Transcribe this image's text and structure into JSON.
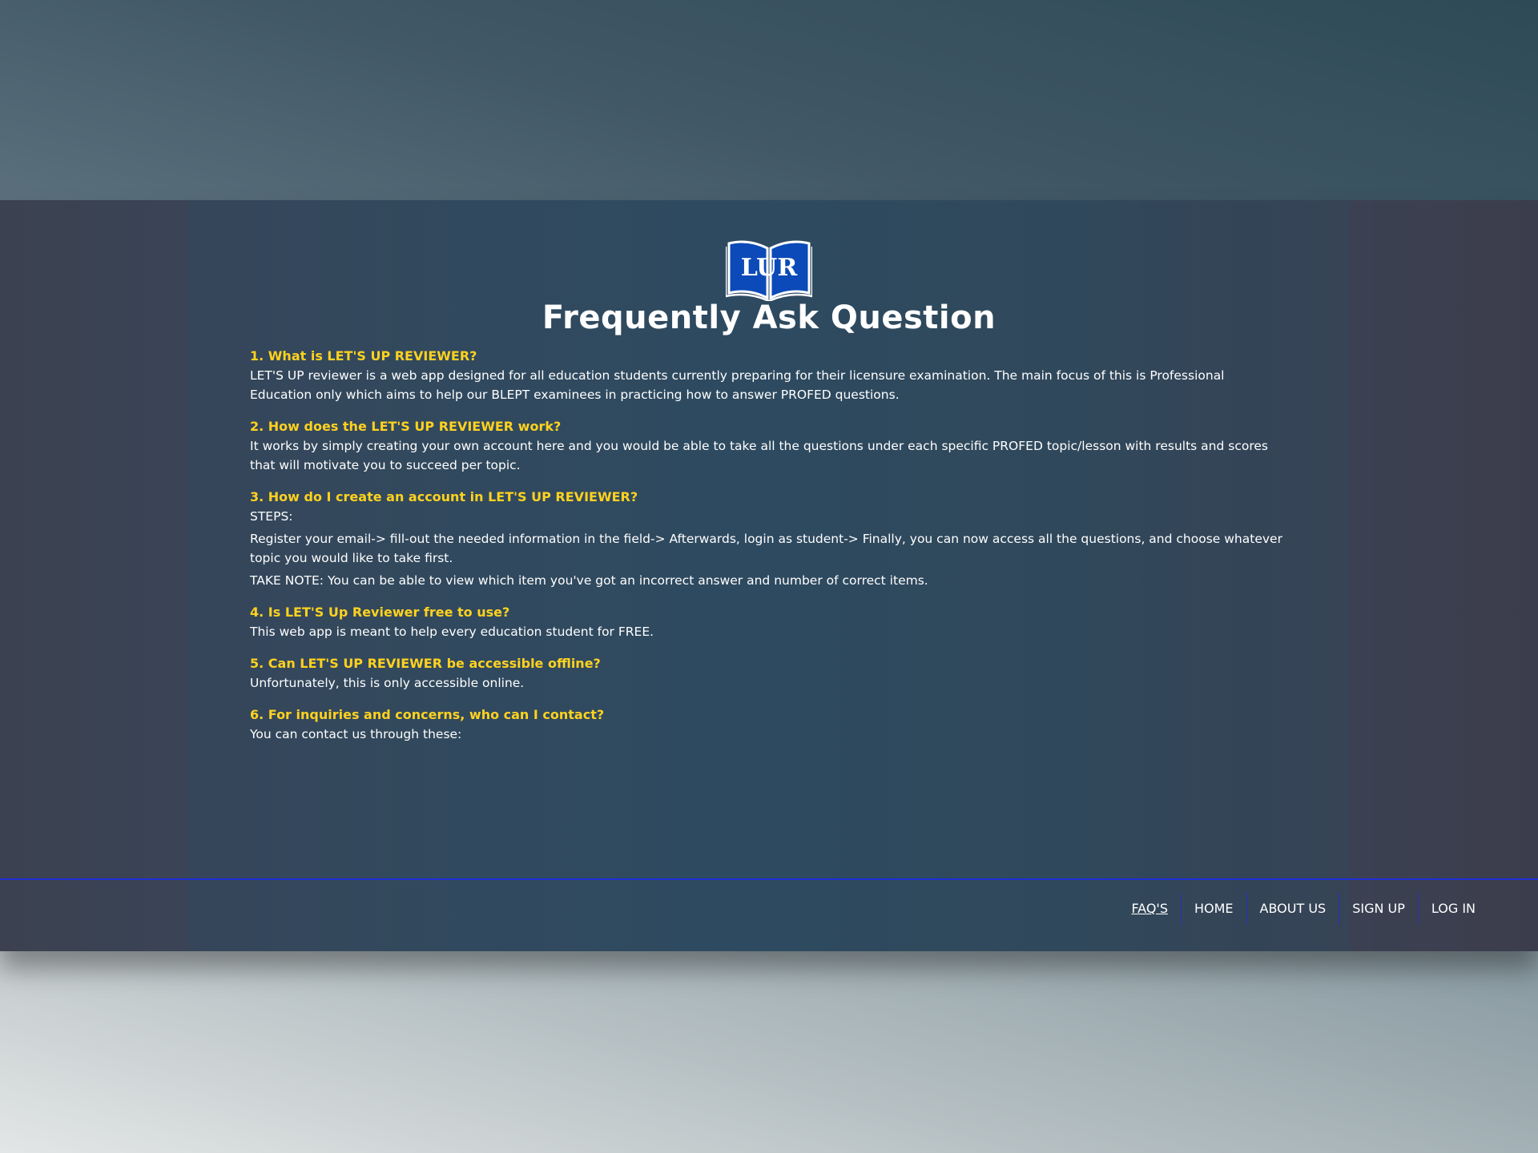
{
  "logo": {
    "letters": "LUR",
    "accent_color": "#0b4ab8"
  },
  "page": {
    "title": "Frequently Ask Question"
  },
  "faqs": [
    {
      "question": "1. What is LET'S UP REVIEWER?",
      "answers": [
        "LET'S UP reviewer is a web app designed for all education students currently preparing for their licensure examination. The main focus of this is Professional Education only which aims to help our BLEPT examinees in practicing how to answer PROFED questions."
      ]
    },
    {
      "question": "2. How does the LET'S UP REVIEWER work?",
      "answers": [
        "It works by simply creating your own account here and you would be able to take all the questions under each specific PROFED topic/lesson with results and scores that will motivate you to succeed per topic."
      ]
    },
    {
      "question": "3. How do I create an account in LET'S UP REVIEWER?",
      "answers": [
        "STEPS:",
        "Register your email-> fill-out the needed information in the field-> Afterwards, login as student-> Finally, you can now access all the questions, and choose whatever topic you would like to take first.",
        "TAKE NOTE: You can be able to view which item you've got an incorrect answer and number of correct items."
      ]
    },
    {
      "question": "4. Is LET'S Up Reviewer free to use?",
      "answers": [
        "This web app is meant to help every education student for FREE."
      ]
    },
    {
      "question": "5. Can LET'S UP REVIEWER be accessible offline?",
      "answers": [
        "Unfortunately, this is only accessible online."
      ]
    },
    {
      "question": "6. For inquiries and concerns, who can I contact?",
      "answers": [
        "You can contact us through these:"
      ]
    }
  ],
  "footer": {
    "nav": [
      {
        "label": "FAQ'S",
        "active": true
      },
      {
        "label": "HOME",
        "active": false
      },
      {
        "label": "ABOUT US",
        "active": false
      },
      {
        "label": "SIGN UP",
        "active": false
      },
      {
        "label": "LOG IN",
        "active": false
      }
    ],
    "divider_color": "#1f2fd6"
  },
  "colors": {
    "question": "#ffd21f",
    "text": "#ffffff"
  }
}
